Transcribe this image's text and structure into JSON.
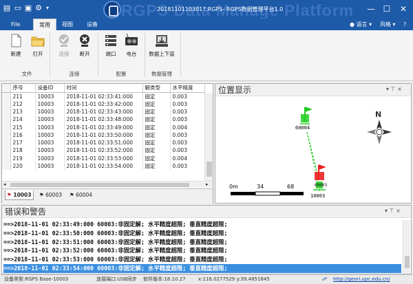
{
  "window": {
    "title": "20181101103017.RGPS- RGPS数据管理平台1.0",
    "watermark": "RGPS Data Manage Platform",
    "minimize": "—",
    "maximize": "☐",
    "close": "✕"
  },
  "quick_access": [
    "new-icon",
    "open-icon",
    "save-icon",
    "settings-icon"
  ],
  "menu": {
    "file": "File",
    "tabs": [
      "常用",
      "视图",
      "设备"
    ],
    "active_tab": "常用",
    "language": "语言",
    "style": "风格",
    "help": "?"
  },
  "ribbon": {
    "groups": [
      {
        "label": "文件",
        "buttons": [
          {
            "label": "新建",
            "icon": "new-file-icon"
          },
          {
            "label": "打开",
            "icon": "open-folder-icon"
          }
        ]
      },
      {
        "label": "连接",
        "buttons": [
          {
            "label": "连接",
            "icon": "connect-check-icon",
            "disabled": true
          },
          {
            "label": "断开",
            "icon": "disconnect-x-icon"
          }
        ]
      },
      {
        "label": "配置",
        "buttons": [
          {
            "label": "端口",
            "icon": "port-icon"
          },
          {
            "label": "电台",
            "icon": "radio-icon"
          }
        ]
      },
      {
        "label": "数据管理",
        "buttons": [
          {
            "label": "数据上下装",
            "icon": "upload-download-icon"
          }
        ]
      }
    ]
  },
  "table": {
    "headers": [
      "序号",
      "设备ID",
      "时间",
      "解类型",
      "水平精度"
    ],
    "rows": [
      [
        "211",
        "10003",
        "2018-11-01 02:33:41:000",
        "固定",
        "0.003"
      ],
      [
        "212",
        "10003",
        "2018-11-01 02:33:42:000",
        "固定",
        "0.003"
      ],
      [
        "213",
        "10003",
        "2018-11-01 02:33:43:000",
        "固定",
        "0.003"
      ],
      [
        "214",
        "10003",
        "2018-11-01 02:33:48:000",
        "固定",
        "0.003"
      ],
      [
        "215",
        "10003",
        "2018-11-01 02:33:49:000",
        "固定",
        "0.004"
      ],
      [
        "216",
        "10003",
        "2018-11-01 02:33:50:000",
        "固定",
        "0.003"
      ],
      [
        "217",
        "10003",
        "2018-11-01 02:33:51:000",
        "固定",
        "0.003"
      ],
      [
        "218",
        "10003",
        "2018-11-01 02:33:52:000",
        "固定",
        "0.003"
      ],
      [
        "219",
        "10003",
        "2018-11-01 02:33:53:000",
        "固定",
        "0.004"
      ],
      [
        "220",
        "10003",
        "2018-11-01 02:33:54:000",
        "固定",
        "0.003"
      ]
    ],
    "device_tabs": [
      "10003",
      "60003",
      "60004"
    ],
    "active_device_tab": "10003"
  },
  "position_panel": {
    "title": "位置显示",
    "pin": "▾ ⊤ ×",
    "north_label": "N",
    "scale": {
      "labels": [
        "0m",
        "34",
        "68"
      ]
    },
    "stations": [
      {
        "label": "60004",
        "color": "#22cc22"
      },
      {
        "label": "60003",
        "color": "#22cc22"
      },
      {
        "label": "10003",
        "color": "#ee2222"
      }
    ]
  },
  "error_panel": {
    "title": "错误和警告",
    "pin": "▾ ⊤ ×",
    "lines": [
      "==>2018-11-01 02:33:49:000  60003:非固定解; 水平精度超限; 垂直精度超限;",
      "==>2018-11-01 02:33:50:000  60003:非固定解; 水平精度超限; 垂直精度超限;",
      "==>2018-11-01 02:33:51:000  60003:非固定解; 水平精度超限; 垂直精度超限;",
      "==>2018-11-01 02:33:52:000  60003:非固定解; 水平精度超限; 垂直精度超限;",
      "==>2018-11-01 02:33:53:000  60003:非固定解; 水平精度超限; 垂直精度超限;",
      "==>2018-11-01 02:33:54:000  60003:非固定解; 水平精度超限; 垂直精度超限;"
    ],
    "selected_index": 5
  },
  "statusbar": {
    "device_type": "设备类型:RGPS Base-10003",
    "port": "连接端口:USB同步",
    "version": "软件版本:18.10.27",
    "coords": "x:116.0277529 y:39.4851845",
    "url": "http://geori.upc.edu.cn/"
  },
  "colors": {
    "titlebar": "#1d5aa8",
    "selection": "#3b8fe0",
    "fixed_station": "#22cc22",
    "base_station": "#ee2222"
  }
}
